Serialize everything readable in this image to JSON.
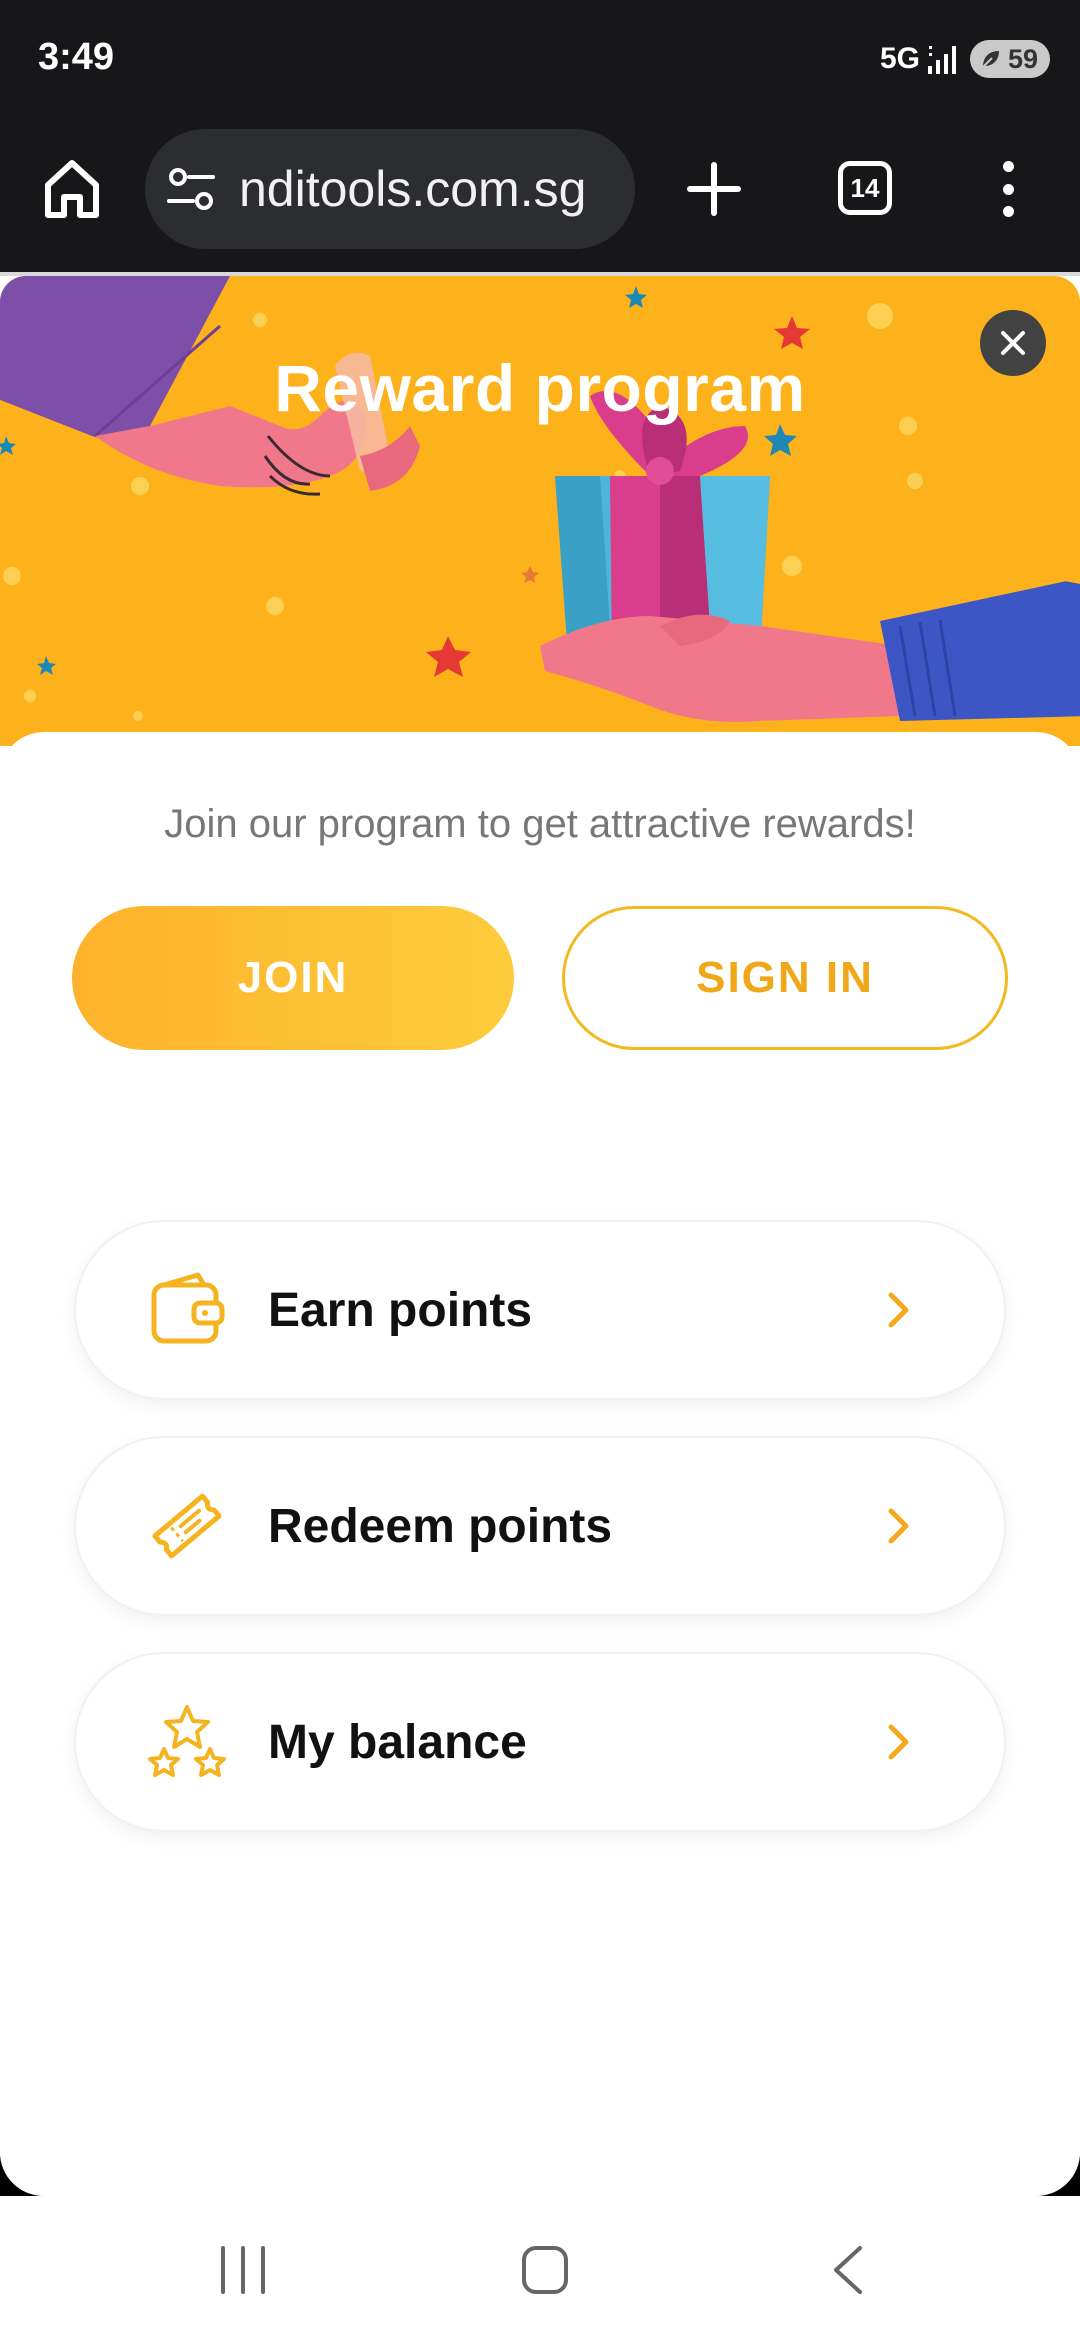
{
  "status_bar": {
    "time": "3:49",
    "network": "5G",
    "battery": "59"
  },
  "browser": {
    "url": "nditools.com.sg",
    "tab_count": "14"
  },
  "reward": {
    "title": "Reward program",
    "tagline": "Join our program to get attractive rewards!",
    "join_label": "JOIN",
    "signin_label": "SIGN IN",
    "items": [
      {
        "label": "Earn points",
        "icon": "wallet-icon"
      },
      {
        "label": "Redeem points",
        "icon": "ticket-icon"
      },
      {
        "label": "My balance",
        "icon": "stars-icon"
      }
    ]
  },
  "colors": {
    "accent": "#f7b322",
    "banner": "#fdb21c",
    "chrome": "#17171a"
  }
}
